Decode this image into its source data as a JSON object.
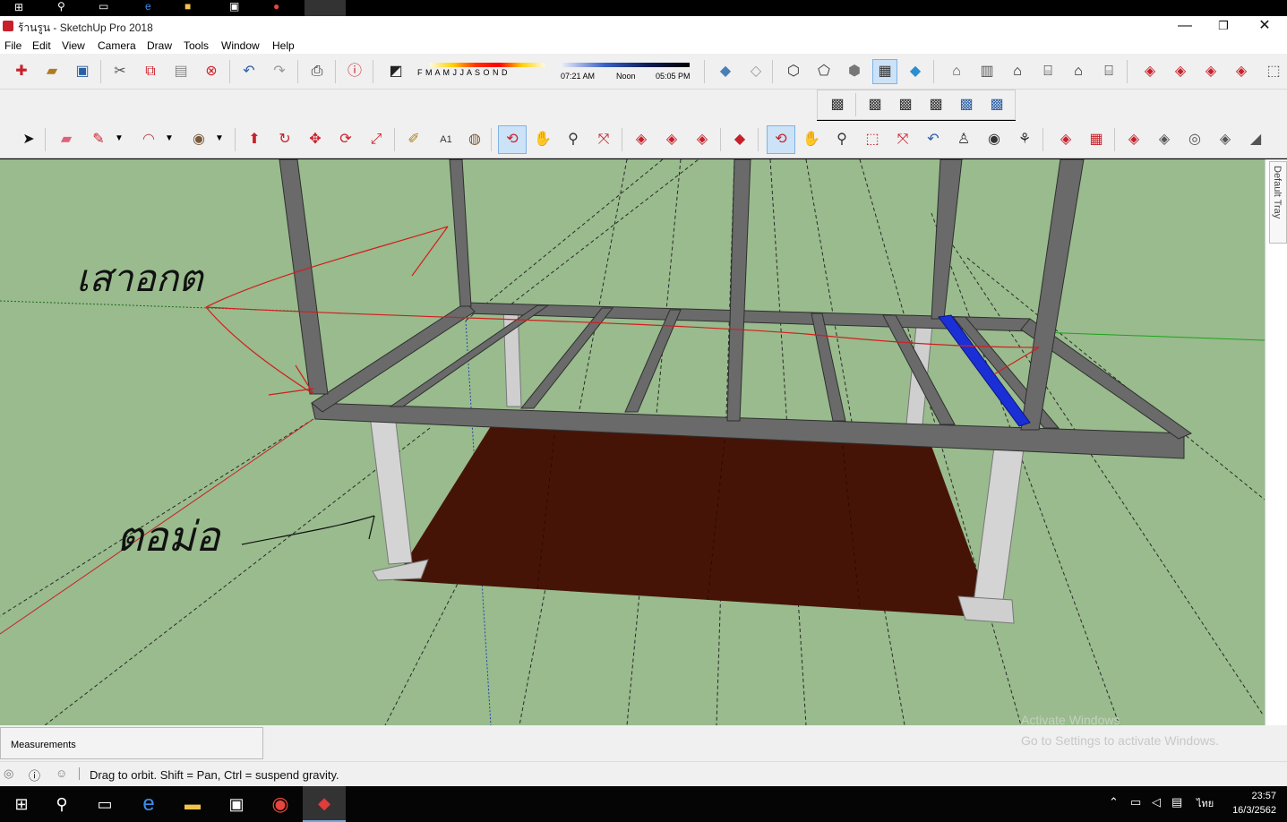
{
  "window": {
    "title": "ร้านรูน - SketchUp Pro 2018",
    "minimize_glyph": "—",
    "restore_glyph": "❐",
    "close_glyph": "✕"
  },
  "menu": {
    "items": [
      {
        "label": "File"
      },
      {
        "label": "Edit"
      },
      {
        "label": "View"
      },
      {
        "label": "Camera"
      },
      {
        "label": "Draw"
      },
      {
        "label": "Tools"
      },
      {
        "label": "Window"
      },
      {
        "label": "Help"
      }
    ]
  },
  "shadow_settings": {
    "months": "F M A M J J A S O N D",
    "time_start": "07:21 AM",
    "time_mid": "Noon",
    "time_end": "05:05 PM"
  },
  "annotations": {
    "upper_text": "เสาอกต",
    "lower_text": "ตอม่อ"
  },
  "tray": {
    "label": "Default Tray"
  },
  "measurements": {
    "label": "Measurements",
    "value": ""
  },
  "watermark": {
    "title": "Activate Windows",
    "subtitle": "Go to Settings to activate Windows."
  },
  "status": {
    "text": "Drag to orbit. Shift = Pan, Ctrl = suspend gravity."
  },
  "taskbar": {
    "time": "23:57",
    "date": "16/3/2562",
    "language": "ไทย"
  },
  "colors": {
    "ground": "#99bb8d",
    "floor": "#461407",
    "beam": "#5f5f5f",
    "selected_beam": "#1b2fd6",
    "annotation_ink": "#d01f1f"
  }
}
